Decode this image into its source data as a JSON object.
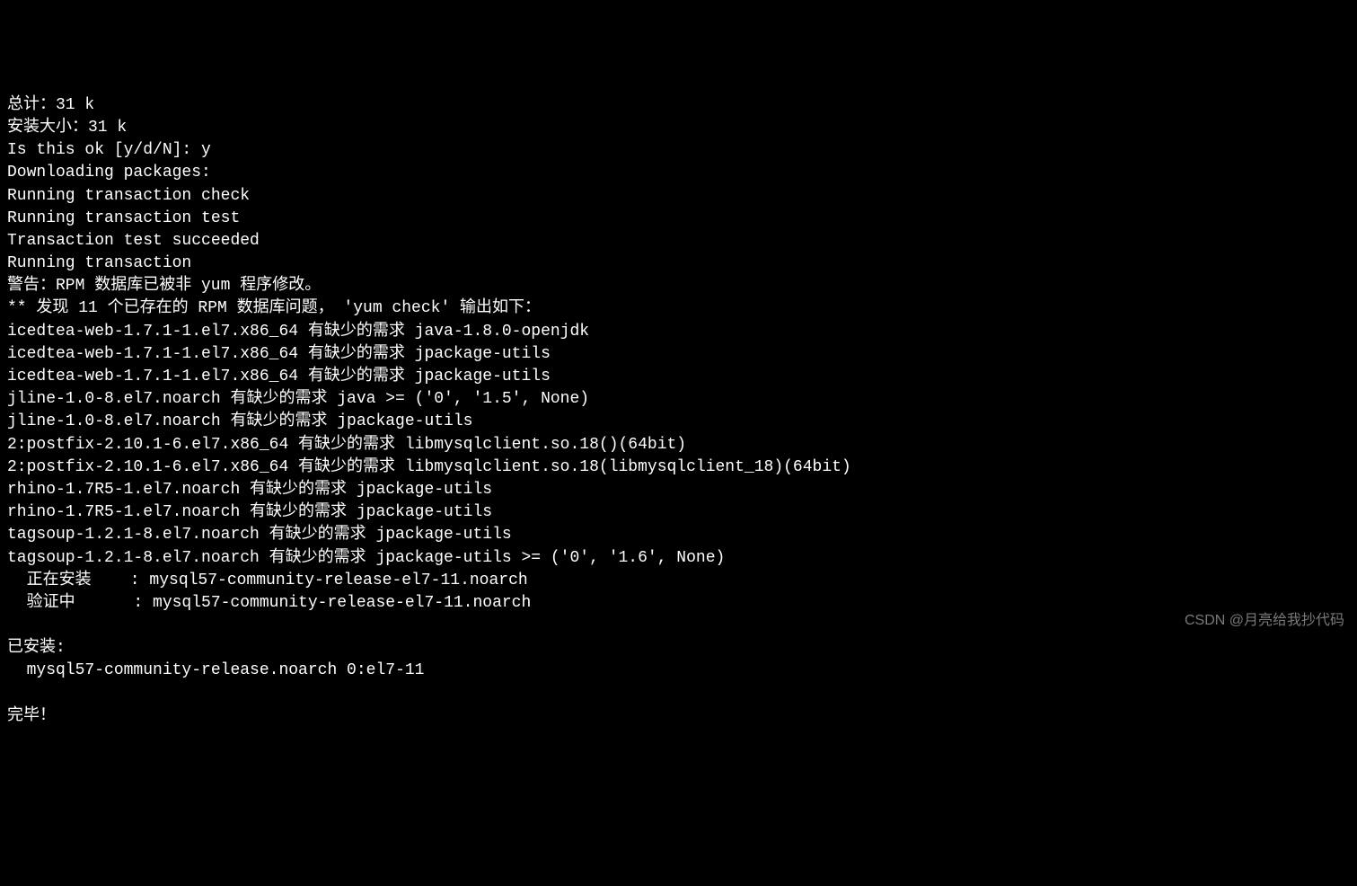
{
  "terminal": {
    "lines": [
      "总计：31 k",
      "安装大小：31 k",
      "Is this ok [y/d/N]: y",
      "Downloading packages:",
      "Running transaction check",
      "Running transaction test",
      "Transaction test succeeded",
      "Running transaction",
      "警告：RPM 数据库已被非 yum 程序修改。",
      "** 发现 11 个已存在的 RPM 数据库问题， 'yum check' 输出如下：",
      "icedtea-web-1.7.1-1.el7.x86_64 有缺少的需求 java-1.8.0-openjdk",
      "icedtea-web-1.7.1-1.el7.x86_64 有缺少的需求 jpackage-utils",
      "icedtea-web-1.7.1-1.el7.x86_64 有缺少的需求 jpackage-utils",
      "jline-1.0-8.el7.noarch 有缺少的需求 java >= ('0', '1.5', None)",
      "jline-1.0-8.el7.noarch 有缺少的需求 jpackage-utils",
      "2:postfix-2.10.1-6.el7.x86_64 有缺少的需求 libmysqlclient.so.18()(64bit)",
      "2:postfix-2.10.1-6.el7.x86_64 有缺少的需求 libmysqlclient.so.18(libmysqlclient_18)(64bit)",
      "rhino-1.7R5-1.el7.noarch 有缺少的需求 jpackage-utils",
      "rhino-1.7R5-1.el7.noarch 有缺少的需求 jpackage-utils",
      "tagsoup-1.2.1-8.el7.noarch 有缺少的需求 jpackage-utils",
      "tagsoup-1.2.1-8.el7.noarch 有缺少的需求 jpackage-utils >= ('0', '1.6', None)",
      "  正在安装    : mysql57-community-release-el7-11.noarch",
      "  验证中      : mysql57-community-release-el7-11.noarch",
      "",
      "已安装:",
      "  mysql57-community-release.noarch 0:el7-11",
      "",
      "完毕！"
    ]
  },
  "watermark": "CSDN @月亮给我抄代码"
}
